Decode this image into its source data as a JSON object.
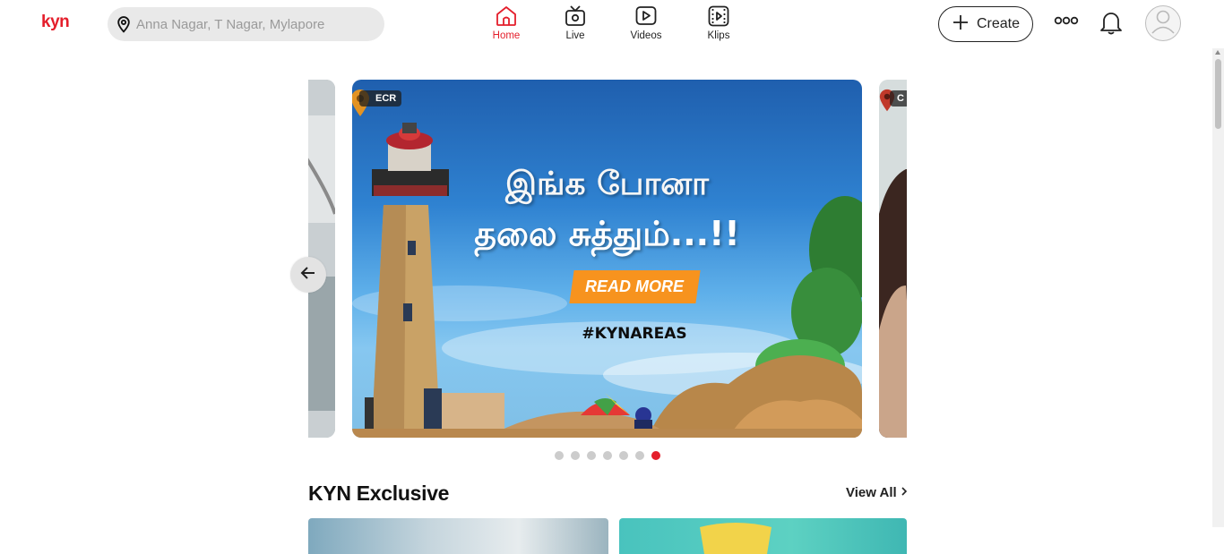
{
  "app": {
    "logo_text": "kyn",
    "brand_color": "#e41e2b"
  },
  "search": {
    "placeholder": "Anna Nagar, T Nagar, Mylapore",
    "value": "",
    "icon": "location-pin-icon"
  },
  "nav": [
    {
      "label": "Home",
      "icon": "home-icon",
      "active": true
    },
    {
      "label": "Live",
      "icon": "live-tv-icon",
      "active": false
    },
    {
      "label": "Videos",
      "icon": "video-play-icon",
      "active": false
    },
    {
      "label": "Klips",
      "icon": "klips-icon",
      "active": false
    }
  ],
  "header_actions": {
    "create_label": "Create",
    "more_icon": "more-dots-icon",
    "notifications_icon": "bell-icon",
    "profile_icon": "avatar-icon"
  },
  "carousel": {
    "slides": [
      {
        "location": "",
        "role": "previous"
      },
      {
        "location": "ECR",
        "headline_line1": "இங்க போனா",
        "headline_line2": "தலை சுத்தும்...!!",
        "cta": "READ MORE",
        "hashtag": "#KYNAREAS",
        "role": "current"
      },
      {
        "location": "C",
        "role": "next"
      }
    ],
    "dot_count": 7,
    "active_dot": 7,
    "colors": {
      "cta": "#f7931e",
      "active_dot": "#e41e2b",
      "dot": "#cccccc"
    }
  },
  "section": {
    "title": "KYN Exclusive",
    "view_all_label": "View All"
  }
}
